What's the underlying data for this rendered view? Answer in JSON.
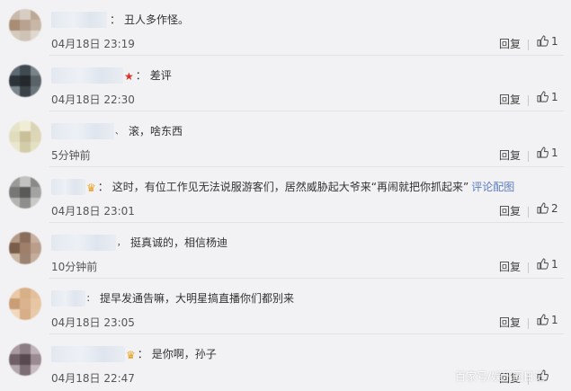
{
  "comments": [
    {
      "tail": "",
      "colon": "：",
      "text": "丑人多作怪。",
      "link": "",
      "time": "04月18日 23:19",
      "reply_label": "回复",
      "like_count": "1",
      "avatar_colors": [
        "#c9b9ab",
        "#d8cdc2",
        "#bda895",
        "#a88c74",
        "#b9a390",
        "#c8b7a6",
        "#d6cbbf",
        "#cfc3b6",
        "#e0d8cf"
      ]
    },
    {
      "tail": "★",
      "colon": "：",
      "text": "差评",
      "link": "",
      "time": "04月18日 22:30",
      "reply_label": "回复",
      "like_count": "1",
      "avatar_colors": [
        "#5e6a72",
        "#3f4950",
        "#79848a",
        "#2d3439",
        "#24292d",
        "#5a6368",
        "#7b868c",
        "#3a4247",
        "#6b757a"
      ]
    },
    {
      "tail": "、",
      "colon": "",
      "text": "滚，啥东西",
      "link": "",
      "time": "5分钟前",
      "reply_label": "回复",
      "like_count": "1",
      "avatar_colors": [
        "#e6e3c9",
        "#efedd6",
        "#d9d5b4",
        "#e1dcbd",
        "#c9c09a",
        "#ddd7b8",
        "#ebe7cf",
        "#d3cca9",
        "#e4e0c4"
      ]
    },
    {
      "tail": "♛",
      "colon": "：",
      "text": "这时，有位工作见无法说服游客们，居然威胁起大爷来“再闹就把你抓起来”",
      "link": "评论配图",
      "time": "04月18日 23:01",
      "reply_label": "回复",
      "like_count": "2",
      "avatar_colors": [
        "#9a9a98",
        "#c2c2c0",
        "#8a8a88",
        "#777776",
        "#5a5a59",
        "#a3a3a1",
        "#b4b4b2",
        "#8e8e8c",
        "#c9c9c7"
      ]
    },
    {
      "tail": "，",
      "colon": "",
      "text": "挺真诚的，相信杨迪",
      "link": "",
      "time": "10分钟前",
      "reply_label": "回复",
      "like_count": "1",
      "avatar_colors": [
        "#b49a86",
        "#8a6e5c",
        "#c7b09d",
        "#7a5e4c",
        "#a07f6a",
        "#b99f8b",
        "#cdb8a6",
        "#9c8270",
        "#c4ad9a"
      ]
    },
    {
      "tail": "：",
      "colon": "",
      "text": "提早发通告嘛，大明星搞直播你们都别来",
      "link": "",
      "time": "04月18日 23:05",
      "reply_label": "回复",
      "like_count": "1",
      "avatar_colors": [
        "#e9c9a6",
        "#d8b088",
        "#e3c09c",
        "#c99d75",
        "#dab48e",
        "#e6c6a3",
        "#f0d9bf",
        "#d6ae87",
        "#e8caa9"
      ]
    },
    {
      "tail": "♛",
      "colon": "：",
      "text": "是你啊，孙子",
      "link": "",
      "time": "04月18日 22:47",
      "reply_label": "回复",
      "like_count": "",
      "avatar_colors": [
        "#a89aa0",
        "#8c7d84",
        "#bfb2b7",
        "#6f6068",
        "#584950",
        "#9a8b92",
        "#b4a7ac",
        "#7d6e75",
        "#c7bbc0"
      ]
    }
  ],
  "watermark": "百家号/娱乐圈日记"
}
